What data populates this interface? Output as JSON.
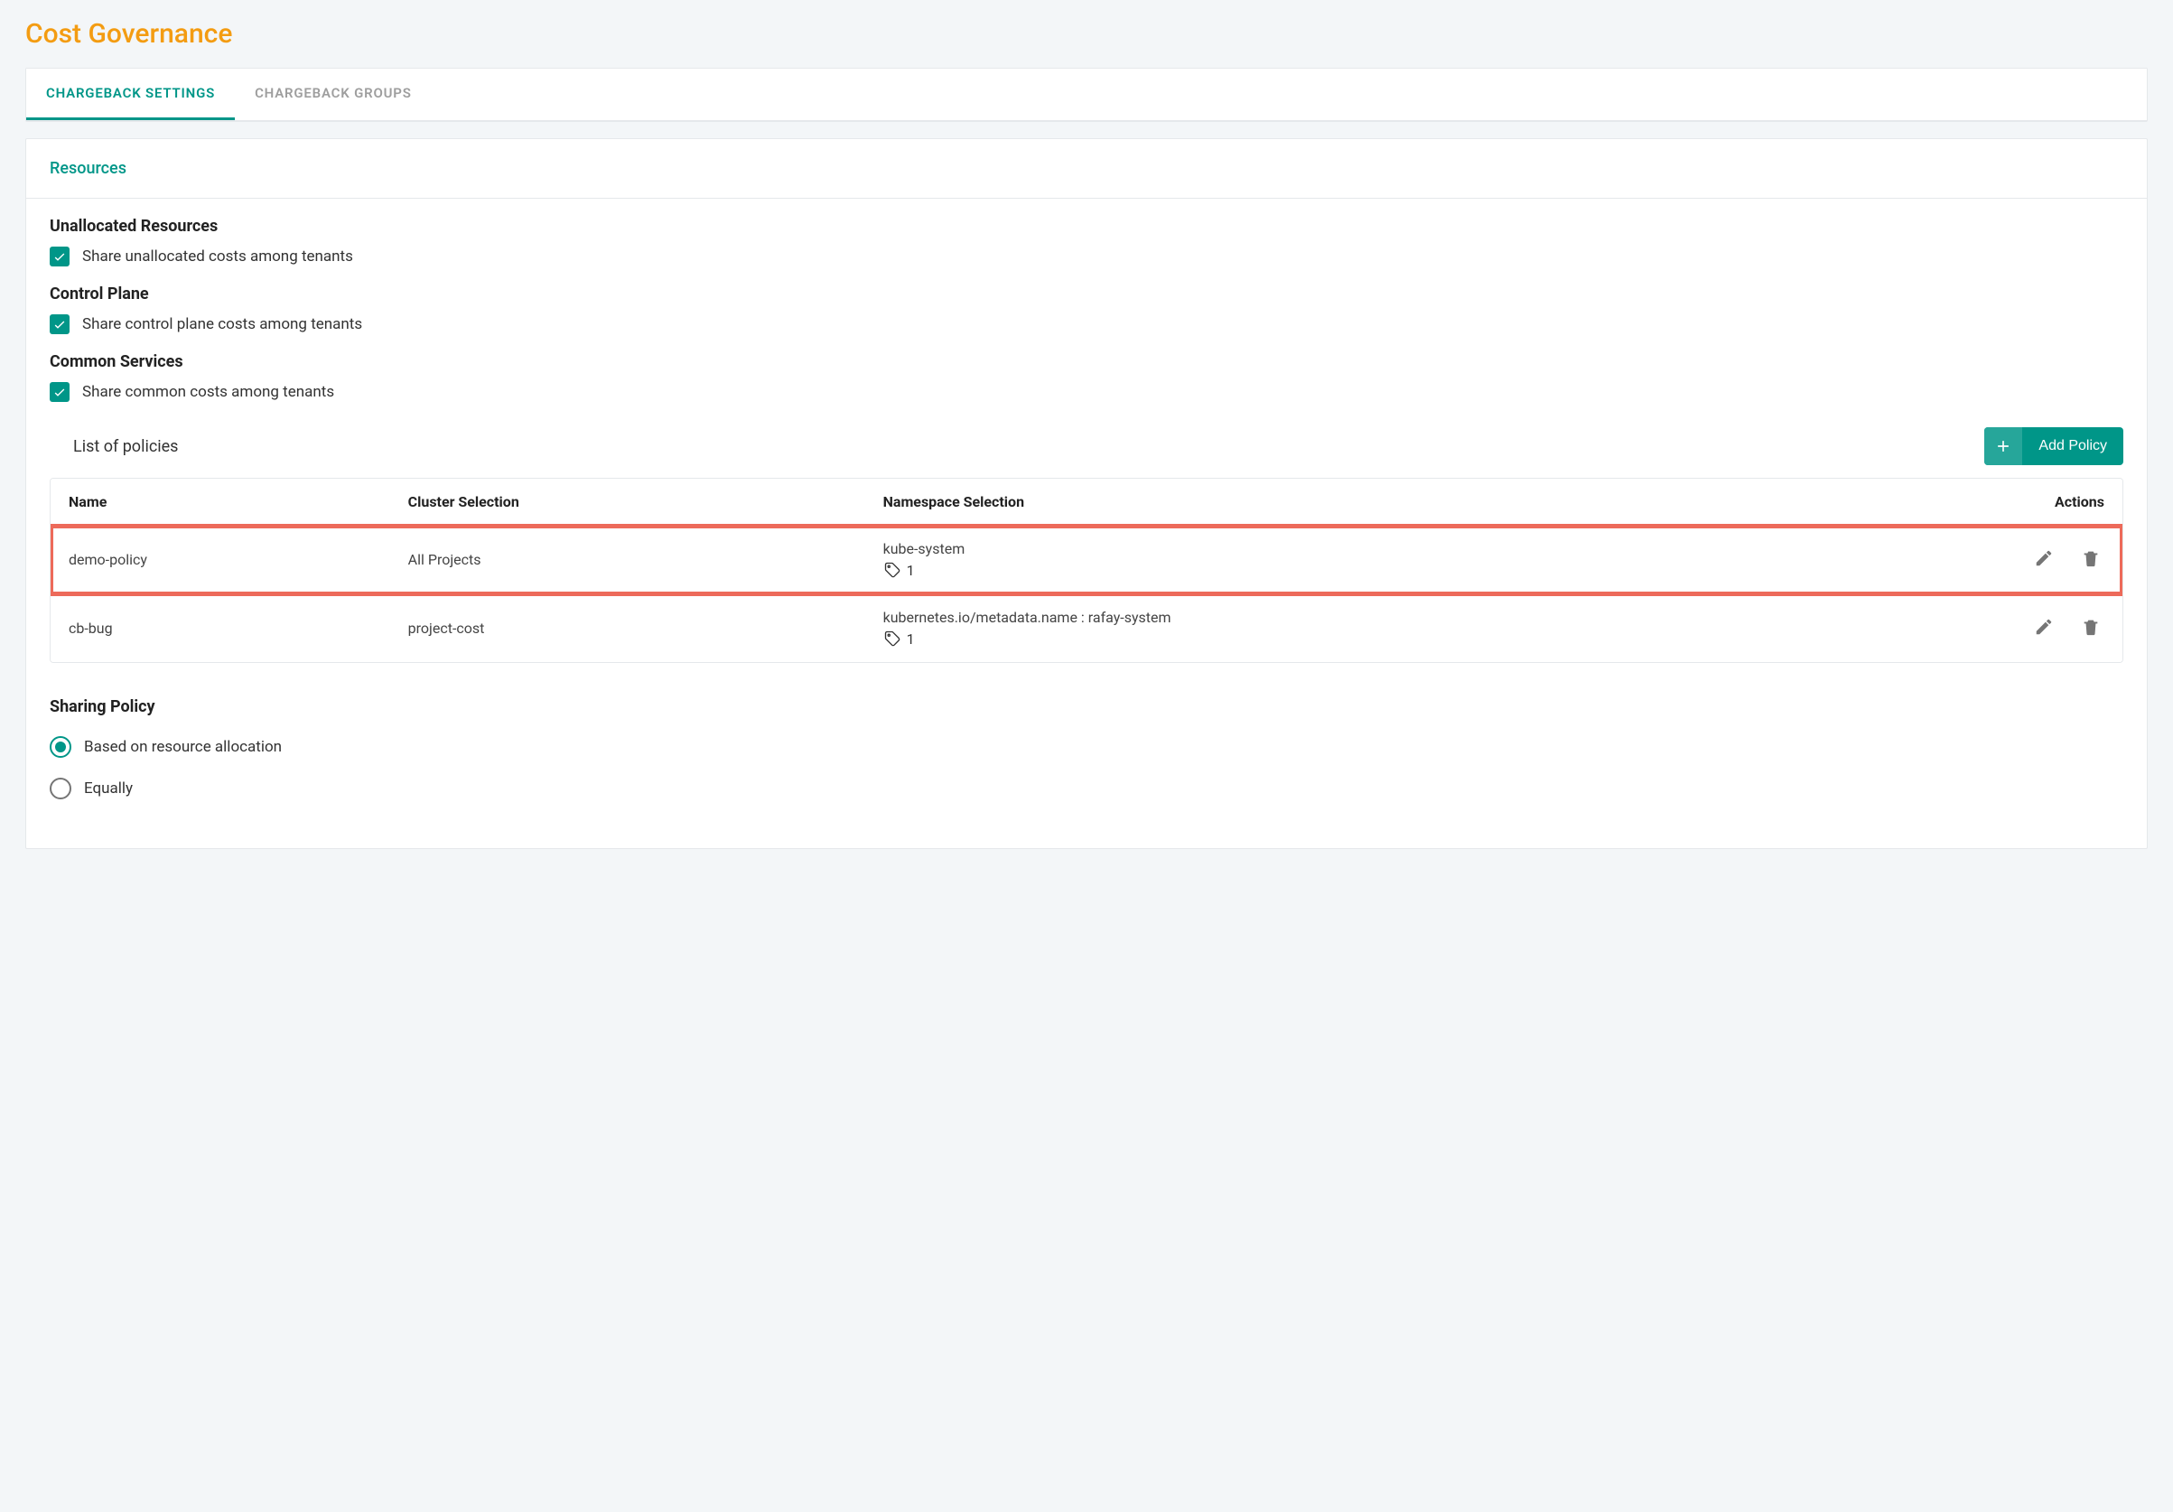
{
  "page": {
    "title": "Cost Governance"
  },
  "tabs": [
    {
      "label": "CHARGEBACK SETTINGS",
      "active": true
    },
    {
      "label": "CHARGEBACK GROUPS",
      "active": false
    }
  ],
  "resources": {
    "header": "Resources",
    "groups": {
      "unallocated": {
        "title": "Unallocated Resources",
        "checkbox_label": "Share unallocated costs among tenants",
        "checked": true
      },
      "controlPlane": {
        "title": "Control Plane",
        "checkbox_label": "Share control plane costs among tenants",
        "checked": true
      },
      "commonServices": {
        "title": "Common Services",
        "checkbox_label": "Share common costs among tenants",
        "checked": true
      }
    }
  },
  "policies": {
    "title": "List of policies",
    "add_button": "Add Policy",
    "columns": {
      "name": "Name",
      "cluster": "Cluster Selection",
      "namespace": "Namespace Selection",
      "actions": "Actions"
    },
    "rows": [
      {
        "name": "demo-policy",
        "cluster": "All Projects",
        "namespace": "kube-system",
        "tagCount": "1",
        "highlighted": true
      },
      {
        "name": "cb-bug",
        "cluster": "project-cost",
        "namespace": "kubernetes.io/metadata.name : rafay-system",
        "tagCount": "1",
        "highlighted": false
      }
    ]
  },
  "sharingPolicy": {
    "title": "Sharing Policy",
    "options": [
      {
        "label": "Based on resource allocation",
        "checked": true
      },
      {
        "label": "Equally",
        "checked": false
      }
    ]
  }
}
